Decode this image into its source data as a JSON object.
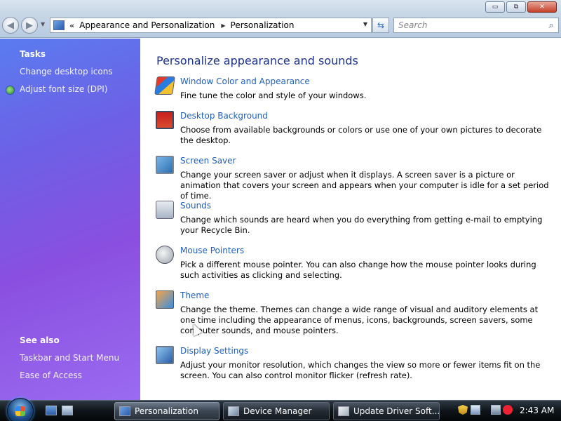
{
  "window": {
    "minimize_label": "▭",
    "maximize_label": "⧉",
    "close_label": "✕"
  },
  "address_bar": {
    "overflow": "«",
    "crumbs": [
      "Appearance and Personalization",
      "Personalization"
    ]
  },
  "search": {
    "placeholder": "Search"
  },
  "tasks": {
    "heading": "Tasks",
    "items": [
      "Change desktop icons",
      "Adjust font size (DPI)"
    ]
  },
  "see_also": {
    "heading": "See also",
    "items": [
      "Taskbar and Start Menu",
      "Ease of Access"
    ]
  },
  "main": {
    "title": "Personalize appearance and sounds",
    "items": [
      {
        "icon": "window-color-icon",
        "link": "Window Color and Appearance",
        "desc": "Fine tune the color and style of your windows."
      },
      {
        "icon": "desktop-background-icon",
        "link": "Desktop Background",
        "desc": "Choose from available backgrounds or colors or use one of your own pictures to decorate the desktop."
      },
      {
        "icon": "screen-saver-icon",
        "link": "Screen Saver",
        "desc": "Change your screen saver or adjust when it displays. A screen saver is a picture or animation that covers your screen and appears when your computer is idle for a set period of time."
      },
      {
        "icon": "sounds-icon",
        "link": "Sounds",
        "desc": "Change which sounds are heard when you do everything from getting e-mail to emptying your Recycle Bin."
      },
      {
        "icon": "mouse-pointers-icon",
        "link": "Mouse Pointers",
        "desc": "Pick a different mouse pointer. You can also change how the mouse pointer looks during such activities as clicking and selecting."
      },
      {
        "icon": "theme-icon",
        "link": "Theme",
        "desc": "Change the theme. Themes can change a wide range of visual and auditory elements at one time including the appearance of menus, icons, backgrounds, screen savers, some computer sounds, and mouse pointers."
      },
      {
        "icon": "display-settings-icon",
        "link": "Display Settings",
        "desc": "Adjust your monitor resolution, which changes the view so more or fewer items fit on the screen. You can also control monitor flicker (refresh rate)."
      }
    ]
  },
  "taskbar": {
    "tasks": [
      "Personalization",
      "Device Manager",
      "Update Driver Soft..."
    ],
    "clock": "2:43 AM"
  },
  "colors": {
    "link": "#1f5fbf",
    "title": "#1e3287",
    "left_pane_top": "#5a7cf0",
    "left_pane_bottom": "#9a6bf0"
  }
}
